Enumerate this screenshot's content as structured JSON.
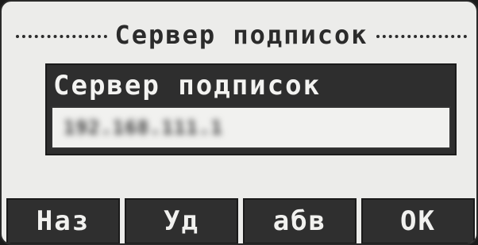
{
  "screen": {
    "title": "Сервер подписок"
  },
  "field": {
    "label": "Сервер подписок",
    "value": "192.168.111.1"
  },
  "softkeys": [
    {
      "label": "Наз"
    },
    {
      "label": "Уд"
    },
    {
      "label": "абв"
    },
    {
      "label": "OK"
    }
  ]
}
